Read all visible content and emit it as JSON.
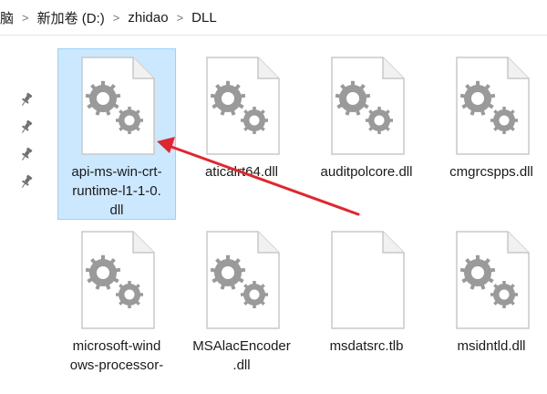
{
  "breadcrumb": {
    "items": [
      "脑",
      "新加卷 (D:)",
      "zhidao",
      "DLL"
    ]
  },
  "quick_access_pins": [
    "pin-icon",
    "pin-icon",
    "pin-icon",
    "pin-icon"
  ],
  "files": [
    {
      "name": "api-ms-win-crt-runtime-l1-1-0.dll",
      "display": "api-ms-win-crt-\nruntime-l1-1-0.\ndll",
      "icon": "gear-file-icon",
      "selected": true
    },
    {
      "name": "aticalrt64.dll",
      "display": "aticalrt64.dll",
      "icon": "gear-file-icon",
      "selected": false
    },
    {
      "name": "auditpolcore.dll",
      "display": "auditpolcore.dll",
      "icon": "gear-file-icon",
      "selected": false
    },
    {
      "name": "cmgrcspps.dll",
      "display": "cmgrcspps.dll",
      "icon": "gear-file-icon",
      "selected": false
    },
    {
      "name": "microsoft-windows-processor-",
      "display": "microsoft-wind\nows-processor-",
      "icon": "gear-file-icon",
      "selected": false
    },
    {
      "name": "MSAlacEncoder.dll",
      "display": "MSAlacEncoder\n.dll",
      "icon": "gear-file-icon",
      "selected": false
    },
    {
      "name": "msdatsrc.tlb",
      "display": "msdatsrc.tlb",
      "icon": "blank-file-icon",
      "selected": false
    },
    {
      "name": "msidntld.dll",
      "display": "msidntld.dll",
      "icon": "gear-file-icon",
      "selected": false
    }
  ],
  "colors": {
    "selection_bg": "#cce8ff",
    "selection_border": "#99d1ff",
    "arrow": "#e0262e",
    "gear": "#9a9a9a"
  },
  "annotation": {
    "type": "arrow",
    "points_to": "api-ms-win-crt-runtime-l1-1-0.dll"
  }
}
